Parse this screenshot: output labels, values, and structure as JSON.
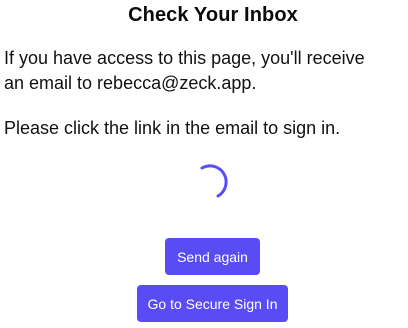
{
  "title": "Check Your Inbox",
  "message": {
    "line1": "If you have access to this page, you'll receive",
    "line2": "an email to rebecca@zeck.app.",
    "instruction": "Please click the link in the email to sign in."
  },
  "spinner": {
    "icon": "loading-spinner-icon",
    "color": "#5a4cf5"
  },
  "buttons": {
    "send_again": "Send again",
    "secure_sign_in": "Go to Secure Sign In"
  },
  "colors": {
    "accent": "#5a4cf5",
    "text": "#111111",
    "background": "#ffffff"
  }
}
